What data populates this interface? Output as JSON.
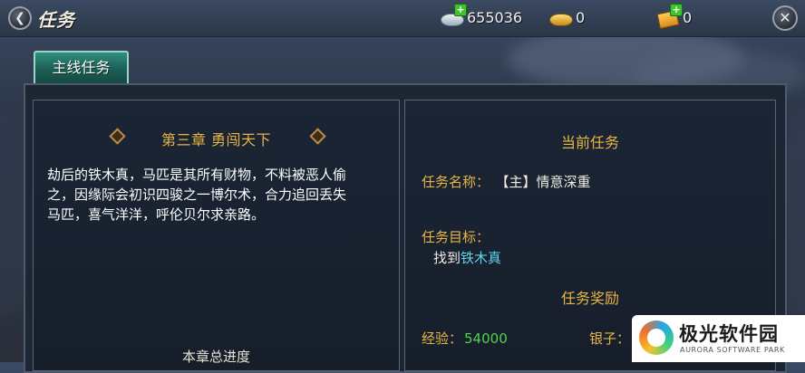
{
  "header": {
    "title": "任务",
    "back_icon": "chevron-left-icon",
    "close_icon": "close-icon"
  },
  "currencies": [
    {
      "name": "silver",
      "icon": "silver-ingot-icon",
      "value": "655036"
    },
    {
      "name": "gold",
      "icon": "gold-ingot-icon",
      "value": "0"
    },
    {
      "name": "ticket",
      "icon": "ticket-icon",
      "value": "0"
    }
  ],
  "tabs": [
    {
      "label": "主线任务",
      "active": true
    }
  ],
  "chapter": {
    "title": "第三章 勇闯天下",
    "story_lines": [
      "劫后的铁木真，马匹是其所有财物，不料被恶人偷",
      "之，因缘际会初识四骏之一博尔术，合力追回丢失",
      "马匹，喜气洋洋，呼伦贝尔求亲路。"
    ],
    "progress_label": "本章总进度"
  },
  "current_task": {
    "heading": "当前任务",
    "name_label": "任务名称：",
    "name_value": "【主】情意深重",
    "goal_label": "任务目标：",
    "goal_prefix": "找到",
    "goal_target": "铁木真"
  },
  "reward": {
    "heading": "任务奖励",
    "exp_label": "经验：",
    "exp_value": "54000",
    "silver_label": "银子："
  },
  "watermark": {
    "title": "极光软件园",
    "subtitle": "AURORA SOFTWARE PARK"
  },
  "colors": {
    "accent_gold": "#e8b544",
    "tab_teal": "#1c5e55",
    "target_cyan": "#5fd4ea",
    "exp_green": "#56d24d"
  }
}
